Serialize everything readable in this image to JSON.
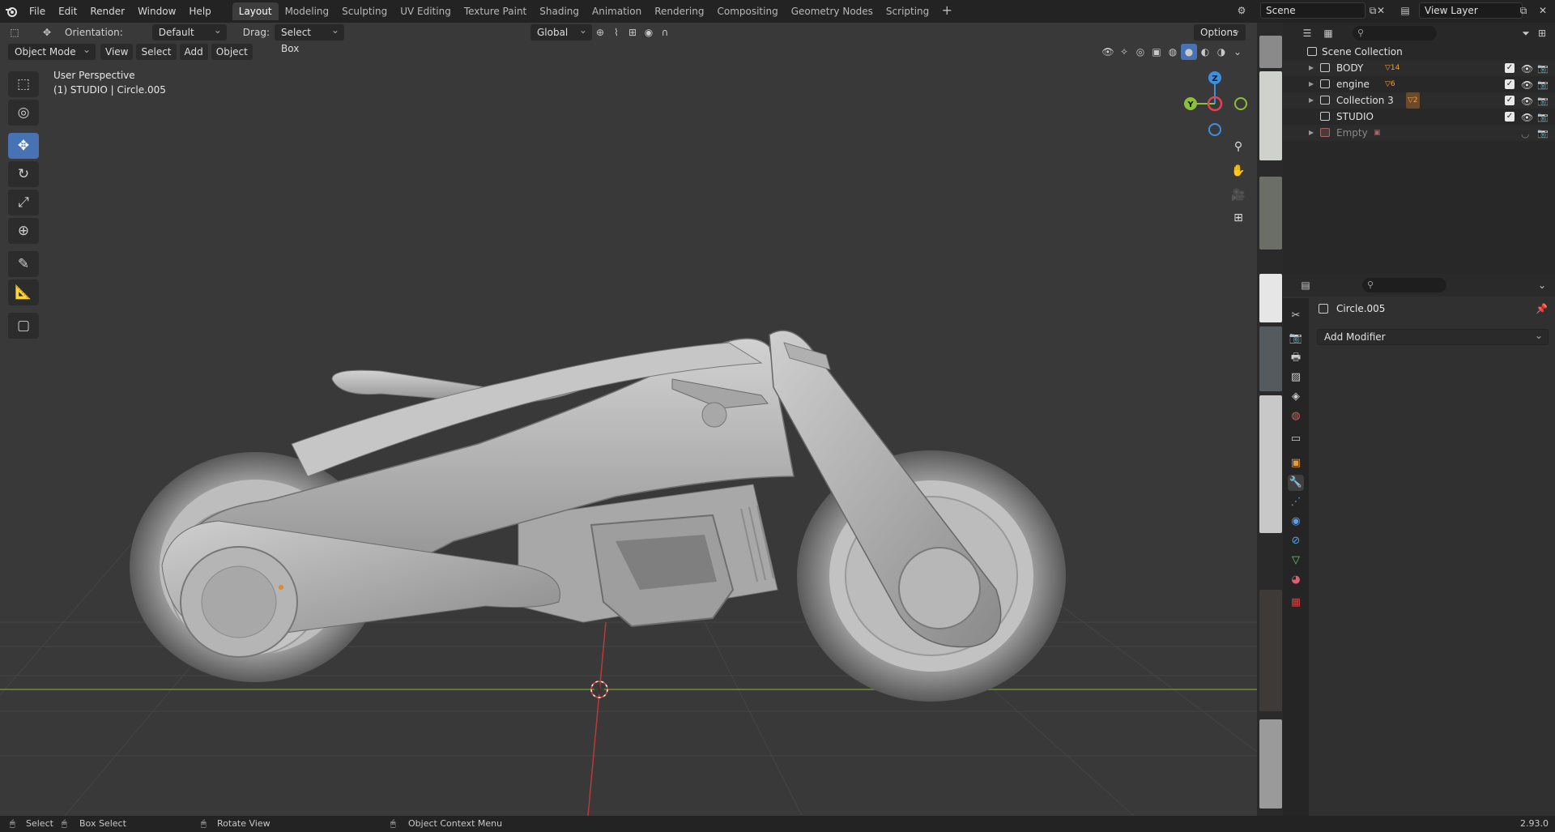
{
  "topbar": {
    "menus": [
      "File",
      "Edit",
      "Render",
      "Window",
      "Help"
    ],
    "workspaces": [
      "Layout",
      "Modeling",
      "Sculpting",
      "UV Editing",
      "Texture Paint",
      "Shading",
      "Animation",
      "Rendering",
      "Compositing",
      "Geometry Nodes",
      "Scripting"
    ],
    "active_workspace": "Layout",
    "scene": "Scene",
    "view_layer": "View Layer"
  },
  "viewport": {
    "orientation_label": "Orientation:",
    "orientation_value": "Default",
    "drag_label": "Drag:",
    "drag_value": "Select Box",
    "transform_space": "Global",
    "options_label": "Options",
    "mode": "Object Mode",
    "menus": [
      "View",
      "Select",
      "Add",
      "Object"
    ],
    "perspective": "User Perspective",
    "context": "(1) STUDIO | Circle.005",
    "gizmo": {
      "x": "X",
      "y": "Y",
      "z": "Z"
    }
  },
  "toolbar": {
    "tools": [
      "select-box-tool",
      "cursor-tool",
      "move-tool",
      "rotate-tool",
      "scale-tool",
      "transform-tool",
      "annotate-tool",
      "measure-tool",
      "add-cube-tool"
    ],
    "active_tool": "move-tool"
  },
  "outliner": {
    "root": "Scene Collection",
    "items": [
      {
        "name": "BODY",
        "badge": "14",
        "expandable": true,
        "dimmed": false
      },
      {
        "name": "engine",
        "badge": "6",
        "expandable": true,
        "dimmed": false
      },
      {
        "name": "Collection 3",
        "badge": "2",
        "expandable": true,
        "dimmed": false
      },
      {
        "name": "STUDIO",
        "badge": "",
        "expandable": false,
        "dimmed": false
      },
      {
        "name": "Empty",
        "badge": "",
        "expandable": true,
        "dimmed": true
      }
    ]
  },
  "properties": {
    "object_name": "Circle.005",
    "add_modifier": "Add Modifier",
    "active_tab": "modifier"
  },
  "statusbar": {
    "select": "Select",
    "box_select": "Box Select",
    "rotate_view": "Rotate View",
    "context_menu": "Object Context Menu",
    "version": "2.93.0"
  },
  "colors": {
    "accent": "#4772b3",
    "axis_x": "#e04550",
    "axis_y": "#8cbf3a",
    "axis_z": "#3d8fe0",
    "viewport_bg": "#393939",
    "model": "#b8b8b8"
  }
}
